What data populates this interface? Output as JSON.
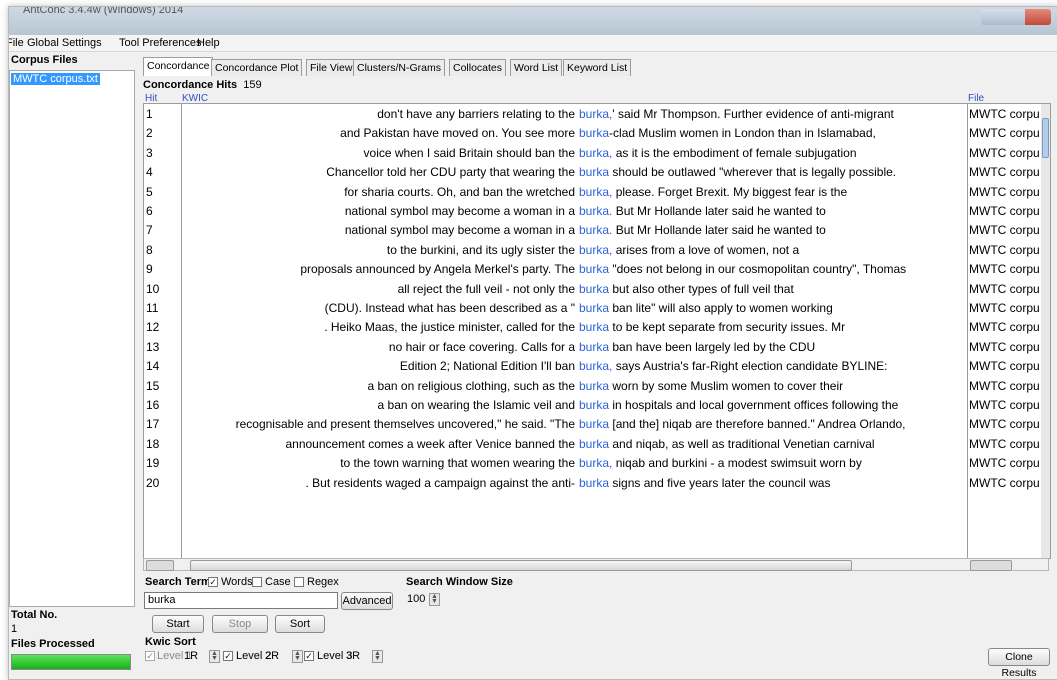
{
  "window": {
    "title": "AntConc 3.4.4w (Windows) 2014"
  },
  "menu": [
    "File",
    "Global Settings",
    "Tool Preferences",
    "Help"
  ],
  "sidebar": {
    "title": "Corpus Files",
    "files": [
      "MWTC corpus.txt"
    ],
    "total_label": "Total No.",
    "total_value": "1",
    "processed_label": "Files Processed",
    "progress_fraction": 1.0
  },
  "tabs": [
    "Concordance",
    "Concordance Plot",
    "File View",
    "Clusters/N-Grams",
    "Collocates",
    "Word List",
    "Keyword List"
  ],
  "concordance": {
    "hits_label": "Concordance Hits",
    "hits_count": "159",
    "col_hit": "Hit",
    "col_kwic": "KWIC",
    "col_file": "File",
    "rows": [
      {
        "hit": "1",
        "left": "don't have any barriers relating to the",
        "kw": "burka,",
        "right": "' said Mr Thompson. Further evidence of anti-migrant",
        "file": "MWTC corpus.txt"
      },
      {
        "hit": "2",
        "left": "and Pakistan have moved on. You see more",
        "kw": "burka",
        "right": "-clad Muslim women in London than in Islamabad,",
        "file": "MWTC corpus.txt"
      },
      {
        "hit": "3",
        "left": "voice when I said Britain should ban the",
        "kw": "burka,",
        "right": "as it is the embodiment of female subjugation",
        "file": "MWTC corpus.txt"
      },
      {
        "hit": "4",
        "left": "Chancellor told her CDU party that wearing the",
        "kw": "burka",
        "right": "should be outlawed \"wherever that is legally possible.",
        "file": "MWTC corpus.txt"
      },
      {
        "hit": "5",
        "left": "for sharia courts. Oh, and ban the wretched",
        "kw": "burka,",
        "right": "please.  Forget Brexit. My biggest fear is the",
        "file": "MWTC corpus.txt"
      },
      {
        "hit": "6",
        "left": "national symbol may become a woman in a",
        "kw": "burka.",
        "right": "But Mr Hollande later said he wanted to",
        "file": "MWTC corpus.txt"
      },
      {
        "hit": "7",
        "left": "national symbol may become a woman in a",
        "kw": "burka.",
        "right": "But Mr Hollande later said he wanted to",
        "file": "MWTC corpus.txt"
      },
      {
        "hit": "8",
        "left": "to the burkini, and its ugly sister the",
        "kw": "burka,",
        "right": "arises from a love of women, not a",
        "file": "MWTC corpus.txt"
      },
      {
        "hit": "9",
        "left": "proposals announced by Angela Merkel's party. The",
        "kw": "burka",
        "right": "\"does not belong in our cosmopolitan country\", Thomas",
        "file": "MWTC corpus.txt"
      },
      {
        "hit": "10",
        "left": "all reject the full veil - not only the",
        "kw": "burka",
        "right": "but also other types of full veil that",
        "file": "MWTC corpus.txt"
      },
      {
        "hit": "11",
        "left": "(CDU). Instead what has been described as a \"",
        "kw": "burka",
        "right": "ban lite\" will also apply to women working",
        "file": "MWTC corpus.txt"
      },
      {
        "hit": "12",
        "left": ". Heiko Maas, the justice minister, called for the",
        "kw": "burka",
        "right": "to be kept separate from security issues.  Mr",
        "file": "MWTC corpus.txt"
      },
      {
        "hit": "13",
        "left": "no hair or face covering.  Calls for a",
        "kw": "burka",
        "right": "ban have been largely led by the CDU",
        "file": "MWTC corpus.txt"
      },
      {
        "hit": "14",
        "left": "Edition 2;                    National Edition  I'll ban",
        "kw": "burka,",
        "right": "says Austria's far-Right election candidate  BYLINE:",
        "file": "MWTC corpus.txt"
      },
      {
        "hit": "15",
        "left": "a ban on religious clothing, such as the",
        "kw": "burka",
        "right": "worn by some Muslim women to cover their",
        "file": "MWTC corpus.txt"
      },
      {
        "hit": "16",
        "left": "a ban on wearing the Islamic veil and",
        "kw": "burka",
        "right": "in hospitals and local government offices following the",
        "file": "MWTC corpus.txt"
      },
      {
        "hit": "17",
        "left": "recognisable and present themselves uncovered,\" he said.  \"The",
        "kw": "burka",
        "right": "[and the] niqab are therefore banned.\"  Andrea Orlando,",
        "file": "MWTC corpus.txt"
      },
      {
        "hit": "18",
        "left": "announcement comes a week after Venice banned the",
        "kw": "burka",
        "right": "and niqab, as well as traditional Venetian carnival",
        "file": "MWTC corpus.txt"
      },
      {
        "hit": "19",
        "left": "to the town warning that women wearing the",
        "kw": "burka,",
        "right": "niqab and burkini - a modest swimsuit worn by",
        "file": "MWTC corpus.txt"
      },
      {
        "hit": "20",
        "left": ". But residents waged a campaign against the anti-",
        "kw": "burka",
        "right": "signs and five years later the council was",
        "file": "MWTC corpus.txt"
      }
    ]
  },
  "search": {
    "term_label": "Search Term",
    "words_label": "Words",
    "words_checked": true,
    "case_label": "Case",
    "case_checked": false,
    "regex_label": "Regex",
    "regex_checked": false,
    "term_value": "burka",
    "advanced_label": "Advanced",
    "window_label": "Search Window Size",
    "window_value": "100"
  },
  "buttons": {
    "start": "Start",
    "stop": "Stop",
    "sort": "Sort",
    "clone": "Clone Results"
  },
  "kwic_sort": {
    "title": "Kwic Sort",
    "level1_label": "Level 1",
    "level1_value": "1R",
    "level2_label": "Level 2",
    "level2_value": "2R",
    "level3_label": "Level 3",
    "level3_value": "3R"
  }
}
